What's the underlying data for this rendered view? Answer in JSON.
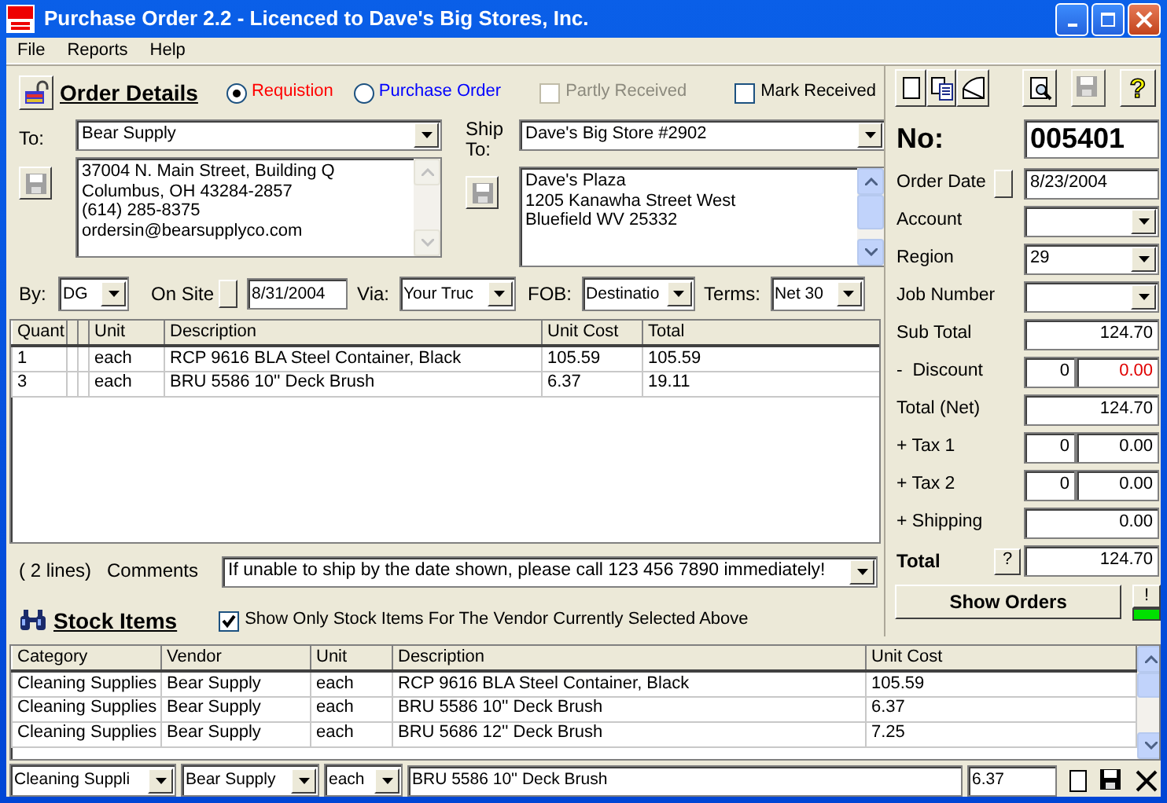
{
  "window": {
    "title": "Purchase Order 2.2 - Licenced to Dave's Big Stores, Inc."
  },
  "menu": [
    "File",
    "Reports",
    "Help"
  ],
  "order_details": {
    "title": "Order Details",
    "order_types": [
      {
        "label": "Requistion",
        "selected": true,
        "color": "#ff0000"
      },
      {
        "label": "Purchase Order",
        "selected": false,
        "color": "#0000ff"
      }
    ],
    "flags": [
      {
        "label": "Partly Received",
        "checked": false,
        "disabled": true
      },
      {
        "label": "Mark Received",
        "checked": false,
        "disabled": false
      }
    ]
  },
  "to": {
    "label": "To:",
    "value": "Bear Supply",
    "address": [
      "37004 N. Main Street, Building Q",
      "Columbus, OH 43284-2857",
      "(614) 285-8375",
      "ordersin@bearsupplyco.com"
    ]
  },
  "ship_to": {
    "label": "Ship To:",
    "value": "Dave's Big Store #2902",
    "address": [
      "Dave's Plaza",
      "1205 Kanawha Street West",
      "Bluefield WV 25332"
    ]
  },
  "details": [
    {
      "label": "By:",
      "kind": "combo",
      "value": "DG"
    },
    {
      "label": "On Site",
      "kind": "date",
      "value": "8/31/2004"
    },
    {
      "label": "Via:",
      "kind": "combo",
      "value": "Your Truc"
    },
    {
      "label": "FOB:",
      "kind": "combo",
      "value": "Destinatio"
    },
    {
      "label": "Terms:",
      "kind": "combo",
      "value": "Net 30"
    }
  ],
  "line_items": {
    "columns": [
      "Quant",
      "Unit",
      "Description",
      "Unit Cost",
      "Total"
    ],
    "rows": [
      [
        "1",
        "each",
        "RCP 9616 BLA Steel Container, Black",
        "105.59",
        "105.59"
      ],
      [
        "3",
        "each",
        "BRU 5586 10'' Deck Brush",
        "6.37",
        "19.11"
      ]
    ]
  },
  "line_count": "( 2 lines)",
  "comments": {
    "label": "Comments",
    "value": "If unable to ship by the date shown, please call 123 456 7890 immediately!"
  },
  "toolbar": [
    {
      "kind": "new",
      "disabled": false
    },
    {
      "kind": "copy",
      "disabled": false
    },
    {
      "kind": "chart",
      "disabled": false
    },
    {
      "kind": "preview",
      "disabled": false
    },
    {
      "kind": "save",
      "disabled": true
    },
    {
      "kind": "help",
      "disabled": false,
      "glyph": "?"
    }
  ],
  "order_no": {
    "label": "No:",
    "value": "005401"
  },
  "order_fields": [
    {
      "label": "Order Date",
      "kind": "date",
      "value": "8/23/2004"
    },
    {
      "label": "Account",
      "kind": "combo"
    },
    {
      "label": "Region",
      "kind": "combo",
      "value": "29"
    },
    {
      "label": "Job Number",
      "kind": "combo"
    },
    {
      "label": "Sub Total",
      "kind": "amount",
      "value": "124.70"
    },
    {
      "label": "-  Discount",
      "kind": "rate",
      "rate": "0",
      "value": "0.00",
      "warning": true
    },
    {
      "label": "Total (Net)",
      "kind": "amount",
      "value": "124.70"
    },
    {
      "label": "+ Tax 1",
      "kind": "rate",
      "rate": "0",
      "value": "0.00",
      "warning": false
    },
    {
      "label": "+ Tax 2",
      "kind": "rate",
      "rate": "0",
      "value": "0.00",
      "warning": false
    },
    {
      "label": "+ Shipping",
      "kind": "amount",
      "value": "0.00"
    },
    {
      "label": "Total",
      "kind": "total",
      "button": "?",
      "value": "124.70"
    }
  ],
  "show_orders": {
    "label": "Show Orders",
    "alert": "!"
  },
  "stock_items": {
    "title": "Stock Items",
    "filter": {
      "label": "Show Only Stock Items For The Vendor Currently Selected Above",
      "checked": true
    },
    "columns": [
      "Category",
      "Vendor",
      "Unit",
      "Description",
      "Unit Cost"
    ],
    "rows": [
      [
        "Cleaning Supplies",
        "Bear Supply",
        "each",
        "RCP 9616 BLA Steel Container, Black",
        "105.59"
      ],
      [
        "Cleaning Supplies",
        "Bear Supply",
        "each",
        "BRU 5586 10'' Deck Brush",
        "6.37"
      ],
      [
        "Cleaning Supplies",
        "Bear Supply",
        "each",
        "BRU 5686 12'' Deck Brush",
        "7.25"
      ]
    ],
    "editor": {
      "category": "Cleaning Suppli",
      "vendor": "Bear Supply",
      "unit": "each",
      "description": "BRU 5586 10'' Deck Brush",
      "unit_cost": "6.37"
    }
  }
}
